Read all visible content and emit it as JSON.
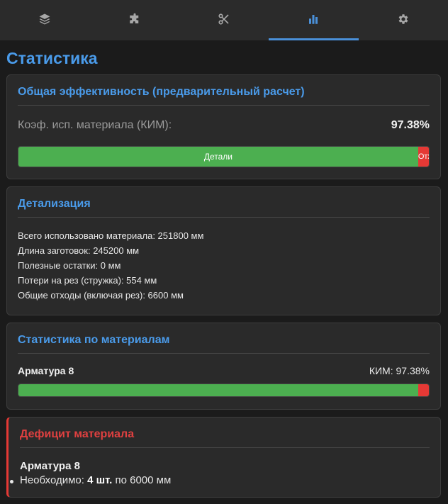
{
  "tabs": [
    {
      "name": "layers-icon",
      "active": false
    },
    {
      "name": "puzzle-icon",
      "active": false
    },
    {
      "name": "scissors-icon",
      "active": false
    },
    {
      "name": "bar-chart-icon",
      "active": true
    },
    {
      "name": "gear-icon",
      "active": false
    }
  ],
  "page": {
    "title": "Статистика"
  },
  "efficiency": {
    "title": "Общая эффективность (предварительный расчет)",
    "kim_label": "Коэф. исп. материала (КИМ):",
    "kim_value": "97.38%",
    "bar": {
      "parts_label": "Детали",
      "parts_percent": 97.38,
      "waste_label": "Отход",
      "waste_percent": 2.62
    }
  },
  "details": {
    "title": "Детализация",
    "lines": [
      "Всего использовано материала: 251800 мм",
      "Длина заготовок: 245200 мм",
      "Полезные остатки: 0 мм",
      "Потери на рез (стружка): 554 мм",
      "Общие отходы (включая рез): 6600 мм"
    ]
  },
  "materials": {
    "title": "Статистика по материалам",
    "items": [
      {
        "name": "Арматура 8",
        "kim_text": "КИМ: 97.38%",
        "percent": 97.38
      }
    ]
  },
  "deficit": {
    "title": "Дефицит материала",
    "material": "Арматура 8",
    "needed_prefix": "Необходимо:",
    "needed_qty": "4 шт.",
    "needed_suffix": "по 6000 мм"
  },
  "colors": {
    "accent": "#4a9bea",
    "green": "#4caf50",
    "red": "#e53935"
  }
}
